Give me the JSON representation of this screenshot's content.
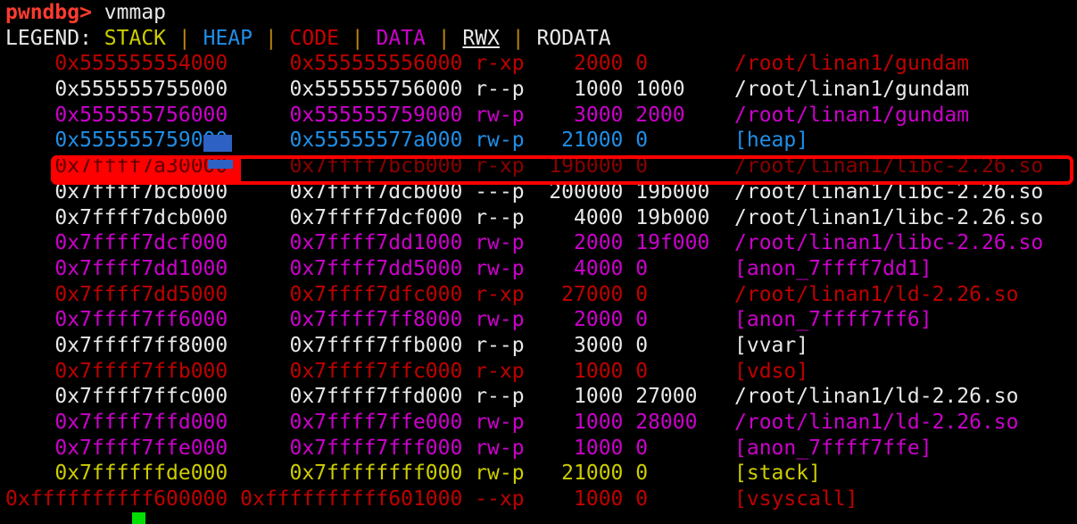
{
  "terminal": {
    "prompt": {
      "name": "pwndbg>",
      "command": "vmmap"
    },
    "legend": {
      "label": "LEGEND:",
      "separator": "|",
      "items": [
        {
          "name": "STACK",
          "color": "#cdcd00"
        },
        {
          "name": "HEAP",
          "color": "#1f8fe8"
        },
        {
          "name": "CODE",
          "color": "#cc0000"
        },
        {
          "name": "DATA",
          "color": "#cc00cc"
        },
        {
          "name": "RWX",
          "color": "#e8e8e8"
        },
        {
          "name": "RODATA",
          "color": "#e8e8e8"
        }
      ]
    },
    "rows": [
      {
        "start": "0x555555554000",
        "end": "0x555555556000",
        "perm": "r-xp",
        "size": "2000",
        "offset": "0",
        "objfile": "/root/linan1/gundam",
        "kind": "code"
      },
      {
        "start": "0x555555755000",
        "end": "0x555555756000",
        "perm": "r--p",
        "size": "1000",
        "offset": "1000",
        "objfile": "/root/linan1/gundam",
        "kind": "rodata"
      },
      {
        "start": "0x555555756000",
        "end": "0x555555759000",
        "perm": "rw-p",
        "size": "3000",
        "offset": "2000",
        "objfile": "/root/linan1/gundam",
        "kind": "data"
      },
      {
        "start": "0x555555759000",
        "end": "0x55555577a000",
        "perm": "rw-p",
        "size": "21000",
        "offset": "0",
        "objfile": "[heap]",
        "kind": "heap"
      },
      {
        "start": "0x7ffff7a30000",
        "end": "0x7ffff7bcb000",
        "perm": "r-xp",
        "size": "19b000",
        "offset": "0",
        "objfile": "/root/linan1/libc-2.26.so",
        "kind": "code",
        "highlighted": true
      },
      {
        "start": "0x7ffff7bcb000",
        "end": "0x7ffff7dcb000",
        "perm": "---p",
        "size": "200000",
        "offset": "19b000",
        "objfile": "/root/linan1/libc-2.26.so",
        "kind": "rodata"
      },
      {
        "start": "0x7ffff7dcb000",
        "end": "0x7ffff7dcf000",
        "perm": "r--p",
        "size": "4000",
        "offset": "19b000",
        "objfile": "/root/linan1/libc-2.26.so",
        "kind": "rodata"
      },
      {
        "start": "0x7ffff7dcf000",
        "end": "0x7ffff7dd1000",
        "perm": "rw-p",
        "size": "2000",
        "offset": "19f000",
        "objfile": "/root/linan1/libc-2.26.so",
        "kind": "data"
      },
      {
        "start": "0x7ffff7dd1000",
        "end": "0x7ffff7dd5000",
        "perm": "rw-p",
        "size": "4000",
        "offset": "0",
        "objfile": "[anon_7ffff7dd1]",
        "kind": "data"
      },
      {
        "start": "0x7ffff7dd5000",
        "end": "0x7ffff7dfc000",
        "perm": "r-xp",
        "size": "27000",
        "offset": "0",
        "objfile": "/root/linan1/ld-2.26.so",
        "kind": "code"
      },
      {
        "start": "0x7ffff7ff6000",
        "end": "0x7ffff7ff8000",
        "perm": "rw-p",
        "size": "2000",
        "offset": "0",
        "objfile": "[anon_7ffff7ff6]",
        "kind": "data"
      },
      {
        "start": "0x7ffff7ff8000",
        "end": "0x7ffff7ffb000",
        "perm": "r--p",
        "size": "3000",
        "offset": "0",
        "objfile": "[vvar]",
        "kind": "rodata"
      },
      {
        "start": "0x7ffff7ffb000",
        "end": "0x7ffff7ffc000",
        "perm": "r-xp",
        "size": "1000",
        "offset": "0",
        "objfile": "[vdso]",
        "kind": "code"
      },
      {
        "start": "0x7ffff7ffc000",
        "end": "0x7ffff7ffd000",
        "perm": "r--p",
        "size": "1000",
        "offset": "27000",
        "objfile": "/root/linan1/ld-2.26.so",
        "kind": "rodata"
      },
      {
        "start": "0x7ffff7ffd000",
        "end": "0x7ffff7ffe000",
        "perm": "rw-p",
        "size": "1000",
        "offset": "28000",
        "objfile": "/root/linan1/ld-2.26.so",
        "kind": "data"
      },
      {
        "start": "0x7ffff7ffe000",
        "end": "0x7ffff7fff000",
        "perm": "rw-p",
        "size": "1000",
        "offset": "0",
        "objfile": "[anon_7ffff7ffe]",
        "kind": "data"
      },
      {
        "start": "0x7ffffffde000",
        "end": "0x7ffffffff000",
        "perm": "rw-p",
        "size": "21000",
        "offset": "0",
        "objfile": "[stack]",
        "kind": "stack"
      },
      {
        "start": "0xffffffffff600000",
        "end": "0xffffffffff601000",
        "perm": "--xp",
        "size": "1000",
        "offset": "0",
        "objfile": "[vsyscall]",
        "kind": "code"
      }
    ],
    "highlight": {
      "color": "#ff0000",
      "row_index": 4
    },
    "cursor": {
      "color": "#00e000"
    }
  }
}
